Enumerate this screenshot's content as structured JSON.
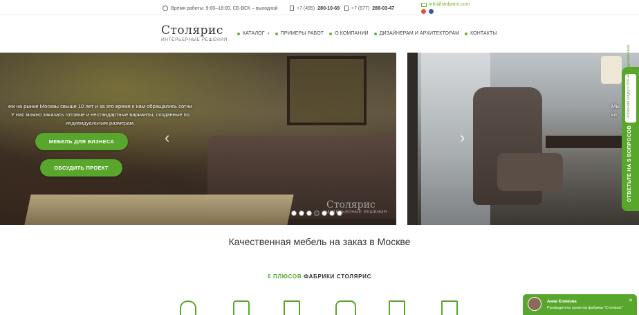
{
  "topbar": {
    "hours": "Время работы: 9:00–18:00, СБ-ВСК – выходной",
    "phone1_prefix": "+7 (495)",
    "phone1_number": "280-10-69",
    "phone2_prefix": "+7 (977)",
    "phone2_number": "288-03-47",
    "email": "info@stolyaris.com",
    "social": [
      "youtube-icon",
      "facebook-icon"
    ]
  },
  "header": {
    "logo_name": "Столярис",
    "logo_sub": "ИНТЕРЬЕРНЫЕ РЕШЕНИЯ",
    "nav": [
      {
        "label": "КАТАЛОГ",
        "has_caret": true
      },
      {
        "label": "ПРИМЕРЫ РАБОТ"
      },
      {
        "label": "О КОМПАНИИ"
      },
      {
        "label": "ДИЗАЙНЕРАМ И АРХИТЕКТОРАМ"
      },
      {
        "label": "КОНТАКТЫ"
      }
    ]
  },
  "slider": {
    "text_line1": "ем на рынке Москвы свыше 10 лет и за это время к нам обращались сотни",
    "text_line2": "У нас можно заказать готовые и нестандартные варианты, созданные по",
    "text_line3": "индивидуальным размерам.",
    "btn1": "МЕБЕЛЬ ДЛЯ БИЗНЕСА",
    "btn2": "ОБСУДИТЬ ПРОЕКТ",
    "watermark_name": "Столярис",
    "watermark_sub": "ИНТЕРЬЕРНЫЕ РЕШЕНИЯ",
    "dots_count": 7,
    "active_dot": 3,
    "second_slide_fragment": "Мы",
    "second_slide_fragment2": "кл"
  },
  "side_tab": {
    "promo": "и получите скидку в 25% на следующий заказ",
    "cta": "ОТВЕТЬТЕ НА 5 ВОПРОСОВ"
  },
  "main": {
    "heading": "Качественная мебель на заказ в Москве",
    "plus_green": "6 ПЛЮСОВ",
    "plus_rest": "ФАБРИКИ СТОЛЯРИС",
    "icons": [
      "quality-badge-icon",
      "thumbs-up-icon",
      "certificate-icon",
      "sofa-icon",
      "document-icon",
      "calendar-icon"
    ]
  },
  "chat": {
    "name": "Анна Климова",
    "role": "Руководитель проектов фабрики \"Столярис\"",
    "close": "✕"
  },
  "colors": {
    "accent": "#58a62c"
  }
}
